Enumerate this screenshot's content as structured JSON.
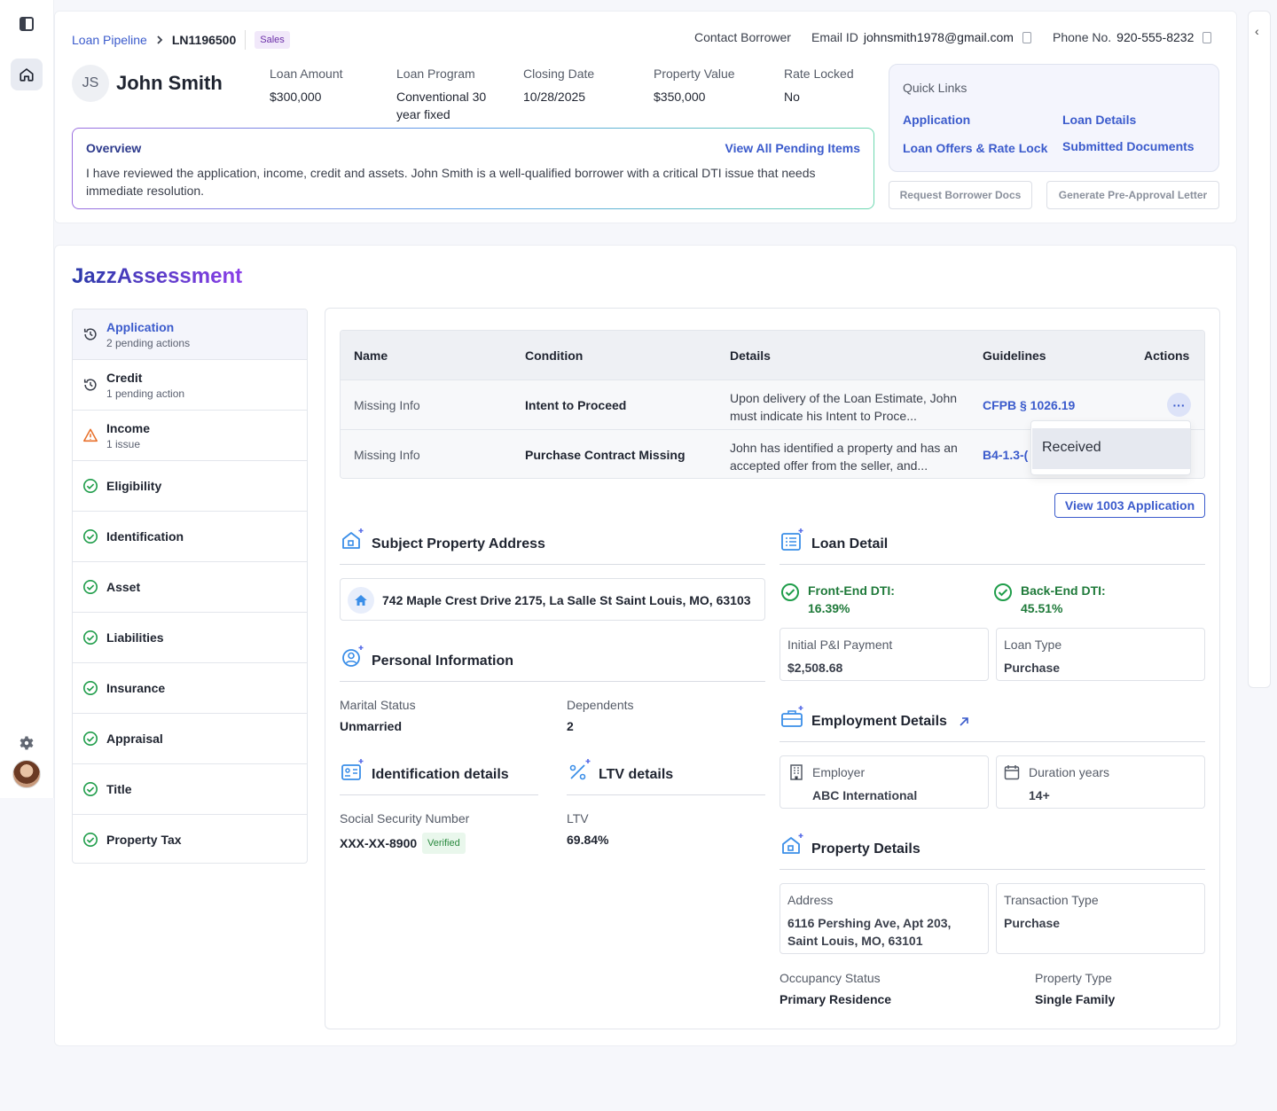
{
  "breadcrumb": {
    "pipeline": "Loan Pipeline",
    "loan_id": "LN1196500",
    "tag": "Sales"
  },
  "contact": {
    "label": "Contact Borrower",
    "email_label": "Email ID",
    "email": "johnsmith1978@gmail.com",
    "phone_label": "Phone No.",
    "phone": "920-555-8232"
  },
  "borrower": {
    "initials": "JS",
    "name": "John Smith"
  },
  "loan_fields": [
    {
      "label": "Loan Amount",
      "value": "$300,000"
    },
    {
      "label": "Loan Program",
      "value": "Conventional 30 year fixed"
    },
    {
      "label": "Closing Date",
      "value": "10/28/2025"
    },
    {
      "label": "Property Value",
      "value": "$350,000"
    },
    {
      "label": "Rate Locked",
      "value": "No"
    }
  ],
  "overview": {
    "title": "Overview",
    "link": "View All Pending Items",
    "text": "I have reviewed the application, income, credit and assets. John Smith is a well-qualified borrower with a critical DTI issue that needs immediate resolution."
  },
  "quick_links": {
    "title": "Quick Links",
    "items": [
      "Application",
      "Loan Details",
      "Loan Offers & Rate Lock",
      "Submitted Documents"
    ]
  },
  "buttons": {
    "request": "Request Borrower Docs",
    "preapproval": "Generate Pre-Approval Letter",
    "view1003": "View 1003 Application"
  },
  "jazz_title": "JazzAssessment",
  "sidebar": [
    {
      "label": "Application",
      "sub": "2 pending actions",
      "status": "pending"
    },
    {
      "label": "Credit",
      "sub": "1 pending action",
      "status": "pending"
    },
    {
      "label": "Income",
      "sub": "1 issue",
      "status": "issue"
    },
    {
      "label": "Eligibility",
      "status": "ok"
    },
    {
      "label": "Identification",
      "status": "ok"
    },
    {
      "label": "Asset",
      "status": "ok"
    },
    {
      "label": "Liabilities",
      "status": "ok"
    },
    {
      "label": "Insurance",
      "status": "ok"
    },
    {
      "label": "Appraisal",
      "status": "ok"
    },
    {
      "label": "Title",
      "status": "ok"
    },
    {
      "label": "Property Tax",
      "status": "ok"
    }
  ],
  "table": {
    "headers": [
      "Name",
      "Condition",
      "Details",
      "Guidelines",
      "Actions"
    ],
    "rows": [
      {
        "name": "Missing Info",
        "condition": "Intent to Proceed",
        "details": "Upon delivery of the Loan Estimate, John must indicate his Intent to Proce...",
        "guideline": "CFPB § 1026.19",
        "action_icon": "more-icon"
      },
      {
        "name": "Missing Info",
        "condition": "Purchase Contract Missing",
        "details": "John has identified a property and has an accepted offer from the seller, and...",
        "guideline": "B4-1.3-("
      }
    ],
    "dropdown_option": "Received"
  },
  "subject_property": {
    "title": "Subject Property Address",
    "address": "742 Maple Crest Drive 2175, La Salle St Saint Louis, MO, 63103"
  },
  "personal": {
    "title": "Personal Information",
    "marital_label": "Marital Status",
    "marital": "Unmarried",
    "dependents_label": "Dependents",
    "dependents": "2"
  },
  "identification": {
    "title": "Identification details",
    "ssn_label": "Social Security Number",
    "ssn": "XXX-XX-8900",
    "badge": "Verified"
  },
  "ltv": {
    "title": "LTV details",
    "label": "LTV",
    "value": "69.84%"
  },
  "loan_detail": {
    "title": "Loan Detail",
    "front_label": "Front-End DTI:",
    "front": "16.39%",
    "back_label": "Back-End DTI:",
    "back": "45.51%",
    "pi_label": "Initial P&I Payment",
    "pi": "$2,508.68",
    "type_label": "Loan Type",
    "type": "Purchase"
  },
  "employment": {
    "title": "Employment Details",
    "employer_label": "Employer",
    "employer": "ABC International",
    "duration_label": "Duration years",
    "duration": "14+"
  },
  "property": {
    "title": "Property Details",
    "address_label": "Address",
    "address": "6116 Pershing Ave, Apt 203, Saint Louis, MO, 63101",
    "transaction_label": "Transaction Type",
    "transaction": "Purchase",
    "occupancy_label": "Occupancy Status",
    "occupancy": "Primary Residence",
    "ptype_label": "Property Type",
    "ptype": "Single Family"
  },
  "colors": {
    "accent": "#3b5bcc",
    "ok": "#1f9d4a",
    "warn": "#e8702a",
    "title_gradient": [
      "#2a3aa8",
      "#8b3fe8"
    ]
  }
}
